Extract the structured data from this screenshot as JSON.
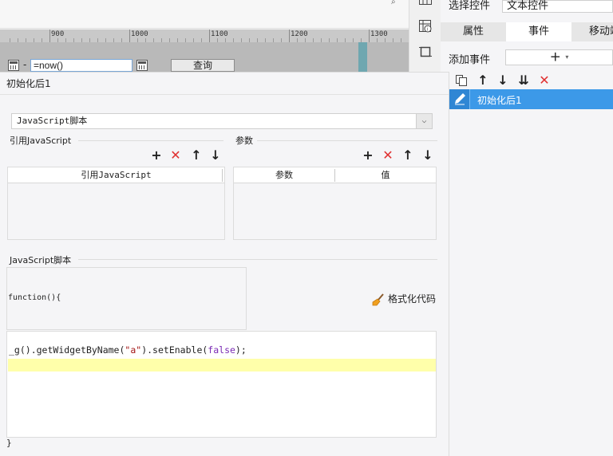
{
  "ruler": {
    "labels": [
      "900",
      "1000",
      "1100",
      "1200",
      "1300"
    ]
  },
  "widget_row": {
    "date_value": "=now()",
    "separator": "-",
    "query_button": "查询"
  },
  "properties": {
    "select_label": "选择控件",
    "select_value": "文本控件",
    "tabs": [
      "属性",
      "事件",
      "移动端"
    ],
    "add_event_label": "添加事件",
    "add_event_button": "+",
    "add_event_arrow": "▾"
  },
  "dialog": {
    "title": "初始化后1",
    "script_type": "JavaScript脚本",
    "ref_section_label": "引用JavaScript",
    "param_section_label": "参数",
    "ref_table": {
      "headers": [
        "引用JavaScript"
      ]
    },
    "param_table": {
      "headers": [
        "参数",
        "值"
      ]
    },
    "script_section_label": "JavaScript脚本",
    "function_header": "function(){",
    "format_button": "格式化代码",
    "code": {
      "line1": {
        "p1": "_g",
        "p2": "().getWidgetByName(",
        "p3": "\"a\"",
        "p4": ").setEnable(",
        "p5": "false",
        "p6": ");"
      }
    },
    "closing": "}"
  },
  "events": {
    "items": [
      {
        "label": "初始化后1"
      }
    ]
  },
  "colors": {
    "accent": "#3c99e8",
    "danger": "#e03030",
    "highlight": "#ffffaa",
    "ruler_marker": "#6fa7b0"
  },
  "icons": [
    "search-icon",
    "calendar-icon",
    "table-icon",
    "image-icon",
    "crop-icon",
    "copy-icon",
    "arrow-up-icon",
    "arrow-down-icon",
    "move-to-bottom-icon",
    "delete-icon",
    "plus-icon",
    "broom-icon",
    "pencil-icon",
    "dropdown-arrow-icon"
  ]
}
